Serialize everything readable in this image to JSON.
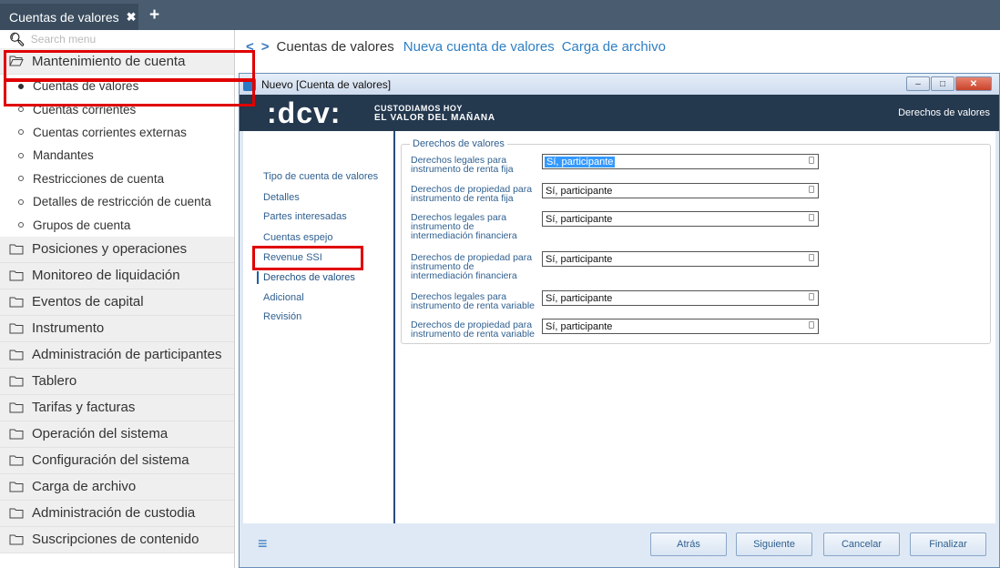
{
  "tabbar": {
    "tab_label": "Cuentas de valores",
    "close_glyph": "✖",
    "add_glyph": "+"
  },
  "sidebar": {
    "search_placeholder": "Search menu",
    "maintenance_group": "Mantenimiento de cuenta",
    "sub_items": [
      "Cuentas de valores",
      "Cuentas corrientes",
      "Cuentas corrientes externas",
      "Mandantes",
      "Restricciones de cuenta",
      "Detalles de restricción de cuenta",
      "Grupos de cuenta"
    ],
    "groups": [
      "Posiciones y operaciones",
      "Monitoreo de liquidación",
      "Eventos de capital",
      "Instrumento",
      "Administración de participantes",
      "Tablero",
      "Tarifas y facturas",
      "Operación del sistema",
      "Configuración del sistema",
      "Carga de archivo",
      "Administración de custodia",
      "Suscripciones de contenido"
    ]
  },
  "breadcrumb": {
    "back_glyph": "<",
    "forward_glyph": ">",
    "current": "Cuentas de valores",
    "links": [
      "Nueva cuenta de valores",
      "Carga de archivo"
    ]
  },
  "window": {
    "title": "Nuevo [Cuenta de valores]",
    "buttons": {
      "minimize": "–",
      "maximize": "□",
      "close": "✕"
    },
    "banner": {
      "logo": ":dcv:",
      "tagline_1": "CUSTODIAMOS HOY",
      "tagline_2": "EL VALOR DEL MAÑANA",
      "section": "Derechos de valores"
    },
    "nav": [
      "Tipo de cuenta de valores",
      "Detalles",
      "Partes interesadas",
      "Cuentas espejo",
      "Revenue SSI",
      "Derechos de valores",
      "Adicional",
      "Revisión"
    ],
    "group_title": "Derechos de valores",
    "fields": [
      {
        "label": "Derechos legales para instrumento de renta fija",
        "value": "Sí, participante"
      },
      {
        "label": "Derechos de propiedad para instrumento de renta fija",
        "value": "Sí, participante"
      },
      {
        "label": "Derechos legales para instrumento de intermediación financiera",
        "value": "Sí, participante"
      },
      {
        "label": "Derechos de propiedad para instrumento de intermediación financiera",
        "value": "Sí, participante"
      },
      {
        "label": "Derechos legales para instrumento de renta variable",
        "value": "Sí, participante"
      },
      {
        "label": "Derechos de propiedad para instrumento de renta variable",
        "value": "Sí, participante"
      }
    ],
    "footer": {
      "menu_glyph": "≡",
      "back": "Atrás",
      "next": "Siguiente",
      "cancel": "Cancelar",
      "finish": "Finalizar"
    }
  },
  "colors": {
    "topbar": "#4a5d70",
    "banner": "#24384e",
    "highlight": "#e00000",
    "link": "#2f7fc3"
  }
}
